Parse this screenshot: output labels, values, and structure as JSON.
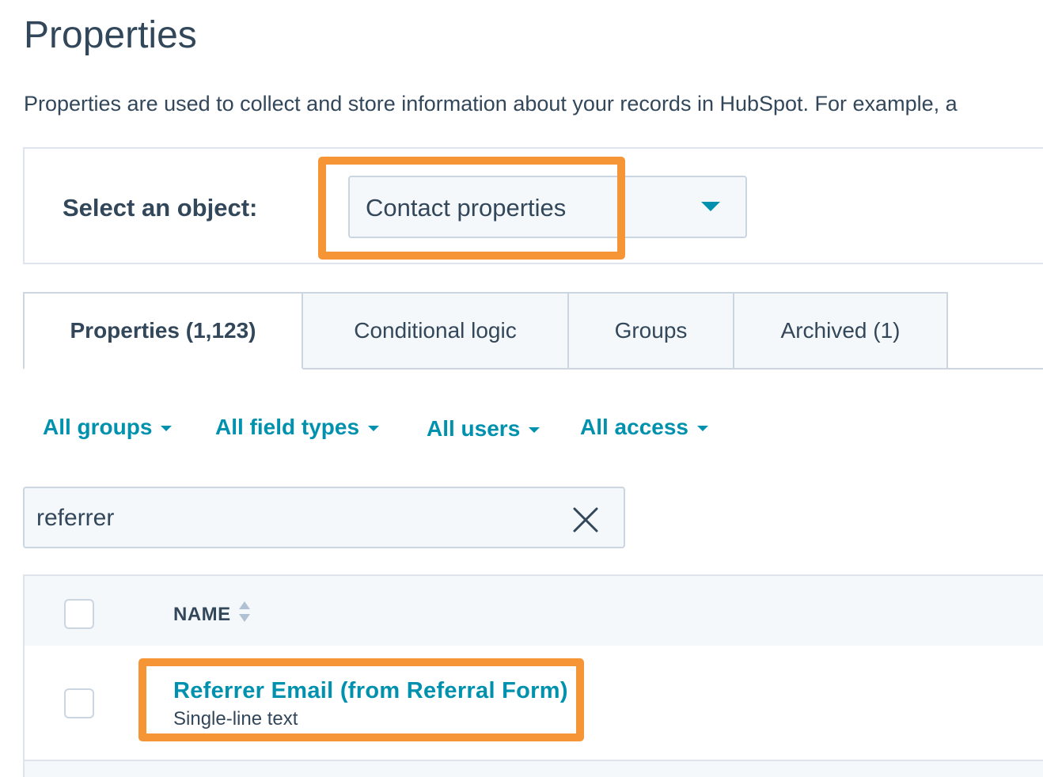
{
  "page": {
    "title": "Properties",
    "description": "Properties are used to collect and store information about your records in HubSpot. For example, a"
  },
  "object_selector": {
    "label": "Select an object:",
    "selected": "Contact properties"
  },
  "tabs": [
    {
      "label": "Properties (1,123)",
      "active": true
    },
    {
      "label": "Conditional logic",
      "active": false
    },
    {
      "label": "Groups",
      "active": false
    },
    {
      "label": "Archived (1)",
      "active": false
    }
  ],
  "filters": [
    {
      "label": "All groups"
    },
    {
      "label": "All field types"
    },
    {
      "label": "All users"
    },
    {
      "label": "All access"
    }
  ],
  "search": {
    "value": "referrer"
  },
  "table": {
    "columns": [
      "NAME"
    ],
    "rows": [
      {
        "name": "Referrer Email (from Referral Form)",
        "type": "Single-line text"
      }
    ]
  },
  "colors": {
    "accent": "#0091ae",
    "highlight": "#f59535",
    "text": "#33475b",
    "border": "#cbd6e2",
    "panel_bg": "#f5f8fa"
  },
  "icons": {
    "dropdown": "caret-down-icon",
    "clear": "close-icon",
    "sort": "sort-icon"
  }
}
